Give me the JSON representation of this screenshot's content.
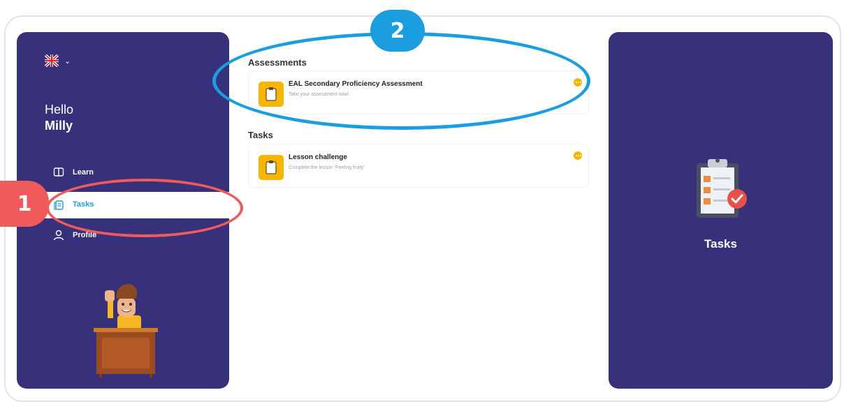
{
  "sidebar": {
    "language_icon": "uk-flag-icon",
    "greeting": "Hello",
    "user_name": "Milly",
    "items": [
      {
        "label": "Learn",
        "icon": "book-icon"
      },
      {
        "label": "Tasks",
        "icon": "tasks-icon"
      },
      {
        "label": "Profile",
        "icon": "user-icon"
      }
    ],
    "active_item": "Tasks"
  },
  "main": {
    "assessments_title": "Assessments",
    "assessment_card": {
      "title": "EAL Secondary Proficiency Assessment",
      "subtitle": "Take your assessment now!",
      "icon": "clipboard-icon"
    },
    "tasks_title": "Tasks",
    "task_card": {
      "title": "Lesson challenge",
      "subtitle": "Complete the lesson 'Feeling fruity'",
      "icon": "clipboard-icon"
    }
  },
  "right_panel": {
    "title": "Tasks",
    "icon": "clipboard-check-icon"
  },
  "annotations": {
    "badge_1": "1",
    "badge_2": "2"
  },
  "colors": {
    "panel": "#36317a",
    "accent_blue": "#1a9ee0",
    "accent_red": "#ef5a5a",
    "accent_yellow": "#f7b500"
  }
}
